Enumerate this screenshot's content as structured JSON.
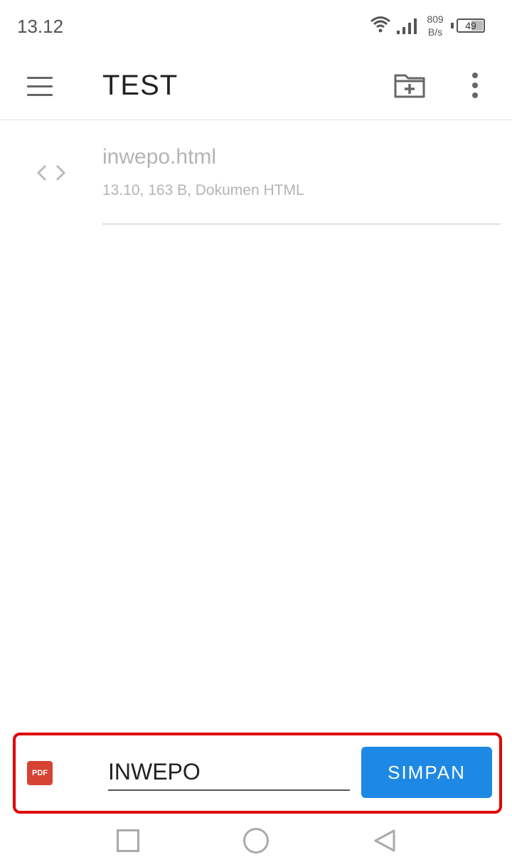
{
  "status_bar": {
    "time": "13.12",
    "net_speed_value": "809",
    "net_speed_unit": "B/s",
    "battery_level": "49",
    "icons": [
      "wifi-icon",
      "signal-icon",
      "battery-icon"
    ]
  },
  "app_bar": {
    "title": "TEST",
    "icons": [
      "menu-icon",
      "new-folder-icon",
      "more-vert-icon"
    ]
  },
  "files": [
    {
      "name": "inwepo.html",
      "meta": "13.10, 163 B, Dokumen HTML",
      "icon": "code-icon"
    }
  ],
  "save_panel": {
    "format_badge": "PDF",
    "filename_value": "INWEPO",
    "save_label": "SIMPAN",
    "accent_color": "#1e88e5",
    "highlight_color": "#e00000"
  },
  "nav_bar": {
    "icons": [
      "recents-icon",
      "home-icon",
      "back-icon"
    ]
  }
}
